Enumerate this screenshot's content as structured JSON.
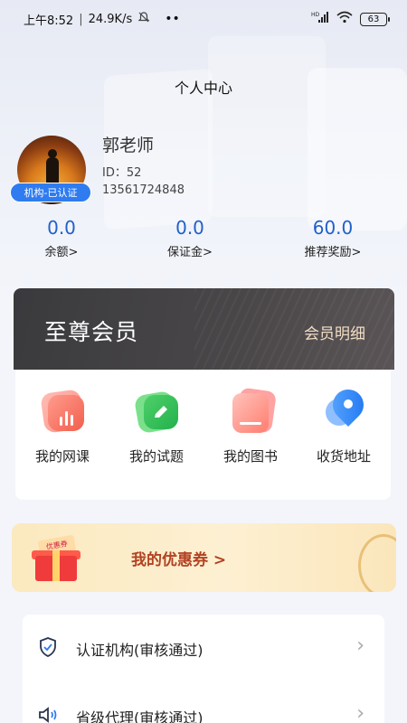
{
  "status_bar": {
    "time": "上午8:52",
    "network_speed": "24.9K/s",
    "signal_label": "HD",
    "battery": "63",
    "icons": [
      "mute-bell-icon",
      "dots-icon",
      "signal-icon",
      "wifi-icon",
      "battery-icon"
    ]
  },
  "page": {
    "title": "个人中心"
  },
  "profile": {
    "name": "郭老师",
    "id": "ID：52",
    "phone": "13561724848",
    "badge": "机构-已认证"
  },
  "stats": [
    {
      "value": "0.0",
      "label": "余额>"
    },
    {
      "value": "0.0",
      "label": "保证金>"
    },
    {
      "value": "60.0",
      "label": "推荐奖励>"
    }
  ],
  "vip": {
    "title": "至尊会员",
    "detail": "会员明细"
  },
  "services": [
    {
      "label": "我的网课",
      "icon": "course-chart-icon"
    },
    {
      "label": "我的试题",
      "icon": "quiz-pencil-icon"
    },
    {
      "label": "我的图书",
      "icon": "book-icon"
    },
    {
      "label": "收货地址",
      "icon": "location-pin-icon"
    }
  ],
  "coupon": {
    "label": "我的优惠券 >",
    "ticket_text": "优惠券"
  },
  "list": [
    {
      "label": "认证机构(审核通过)",
      "icon": "shield-check-icon"
    },
    {
      "label": "省级代理(审核通过)",
      "icon": "speaker-icon"
    }
  ],
  "colors": {
    "accent_blue": "#2061c9",
    "badge_blue": "#2f7cf0",
    "vip_dark": "#3a3a3d",
    "vip_gold_text": "#f2ddc4",
    "coupon_text": "#b24222"
  }
}
